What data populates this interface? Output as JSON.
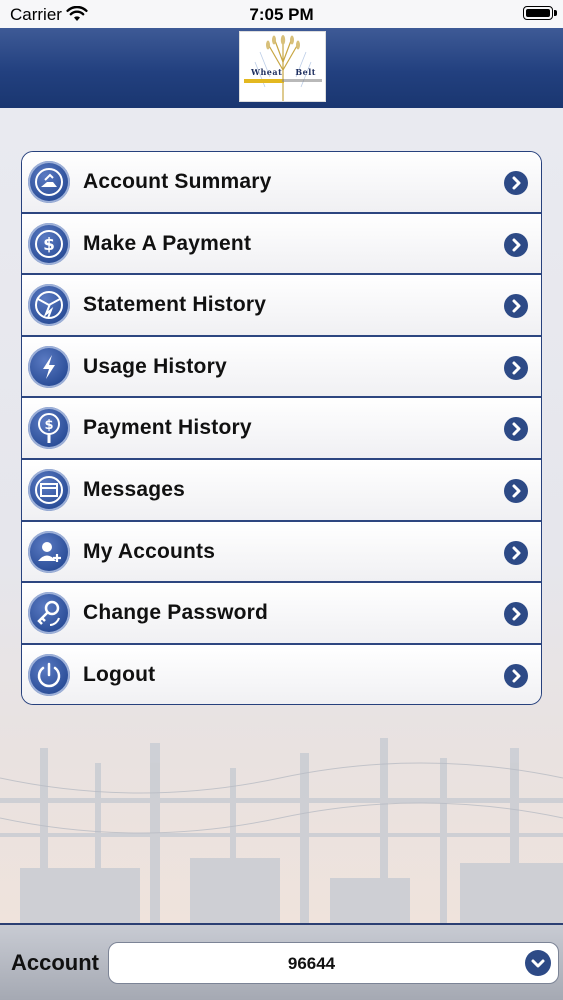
{
  "status_bar": {
    "carrier": "Carrier",
    "time": "7:05 PM"
  },
  "header": {
    "logo_text": "Wheat    Belt"
  },
  "menu": {
    "items": [
      {
        "label": "Account Summary",
        "icon": "account-summary-icon"
      },
      {
        "label": "Make A Payment",
        "icon": "dollar-icon"
      },
      {
        "label": "Statement History",
        "icon": "statement-icon"
      },
      {
        "label": "Usage History",
        "icon": "lightning-icon"
      },
      {
        "label": "Payment History",
        "icon": "payment-history-icon"
      },
      {
        "label": "Messages",
        "icon": "messages-icon"
      },
      {
        "label": "My Accounts",
        "icon": "add-user-icon"
      },
      {
        "label": "Change Password",
        "icon": "key-icon"
      },
      {
        "label": "Logout",
        "icon": "power-icon"
      }
    ]
  },
  "footer": {
    "account_label": "Account",
    "account_value": "96644"
  },
  "colors": {
    "brand": "#22407f",
    "chevron": "#2d4a86"
  }
}
